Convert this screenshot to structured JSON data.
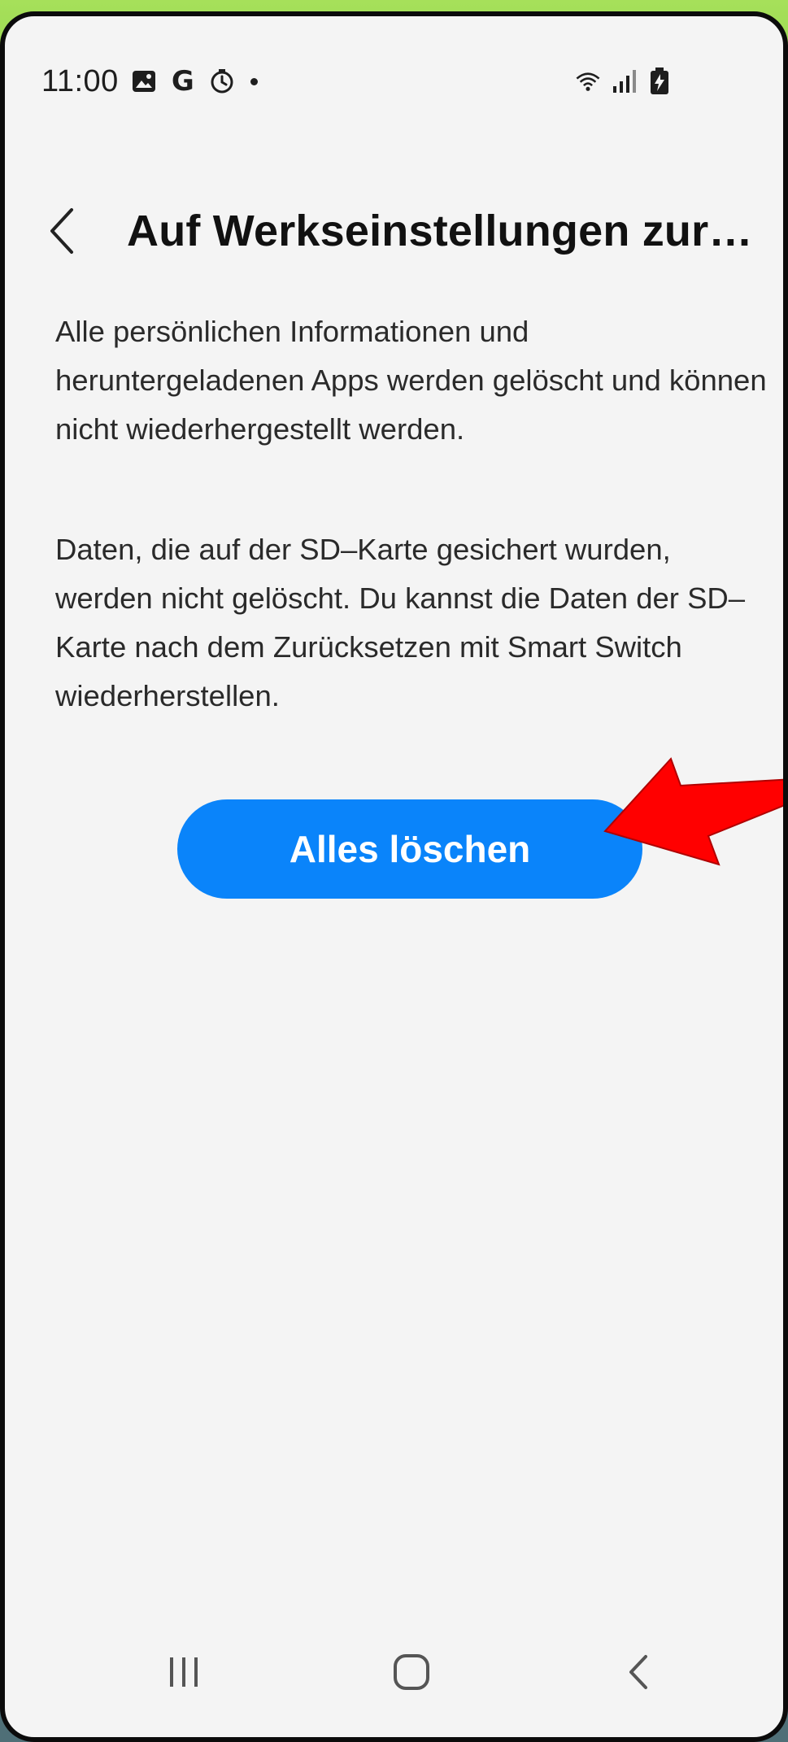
{
  "status_bar": {
    "time": "11:00",
    "g_icon": "G",
    "icons_left": [
      "gallery-icon",
      "google-icon",
      "timer-icon",
      "dot-icon"
    ],
    "icons_right": [
      "wifi-icon",
      "signal-icon",
      "battery-charging-icon"
    ]
  },
  "header": {
    "back_icon": "chevron-left-icon",
    "title": "Auf Werkseinstellungen zur…"
  },
  "content": {
    "paragraph_1": "Alle persönlichen Informationen und heruntergeladenen Apps werden gelöscht und können nicht wiederhergestellt werden.",
    "paragraph_2": "Daten, die auf der SD–Karte gesichert wurden, werden nicht gelöscht. Du kannst die Daten der SD–Karte nach dem Zurücksetzen mit Smart Switch wiederherstellen."
  },
  "actions": {
    "delete_all_label": "Alles löschen"
  },
  "annotation": {
    "arrow_color": "#ff0000"
  },
  "nav_bar": {
    "items": [
      "recents-icon",
      "home-icon",
      "back-icon"
    ]
  },
  "colors": {
    "accent": "#0a84fa",
    "background": "#f4f4f4",
    "text": "#2a2a2a"
  }
}
